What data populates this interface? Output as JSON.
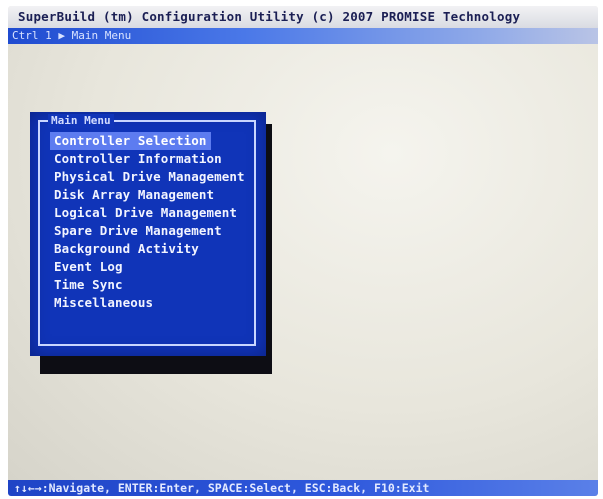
{
  "title_bar": {
    "text": "SuperBuild (tm) Configuration Utility (c) 2007 PROMISE Technology"
  },
  "breadcrumb": {
    "text": "Ctrl 1 ▶ Main Menu"
  },
  "main_menu": {
    "title": "Main Menu",
    "selected_index": 0,
    "items": [
      {
        "label": "Controller Selection"
      },
      {
        "label": "Controller Information"
      },
      {
        "label": "Physical Drive Management"
      },
      {
        "label": "Disk Array Management"
      },
      {
        "label": "Logical Drive Management"
      },
      {
        "label": "Spare Drive Management"
      },
      {
        "label": "Background Activity"
      },
      {
        "label": "Event Log"
      },
      {
        "label": "Time Sync"
      },
      {
        "label": "Miscellaneous"
      }
    ]
  },
  "status_bar": {
    "text": "↑↓←→:Navigate, ENTER:Enter, SPACE:Select, ESC:Back, F10:Exit"
  },
  "colors": {
    "menu_background": "#1034b8",
    "menu_selected": "#5d7cf0",
    "bar_blue": "#1f44c6",
    "title_text": "#1b1f54"
  }
}
